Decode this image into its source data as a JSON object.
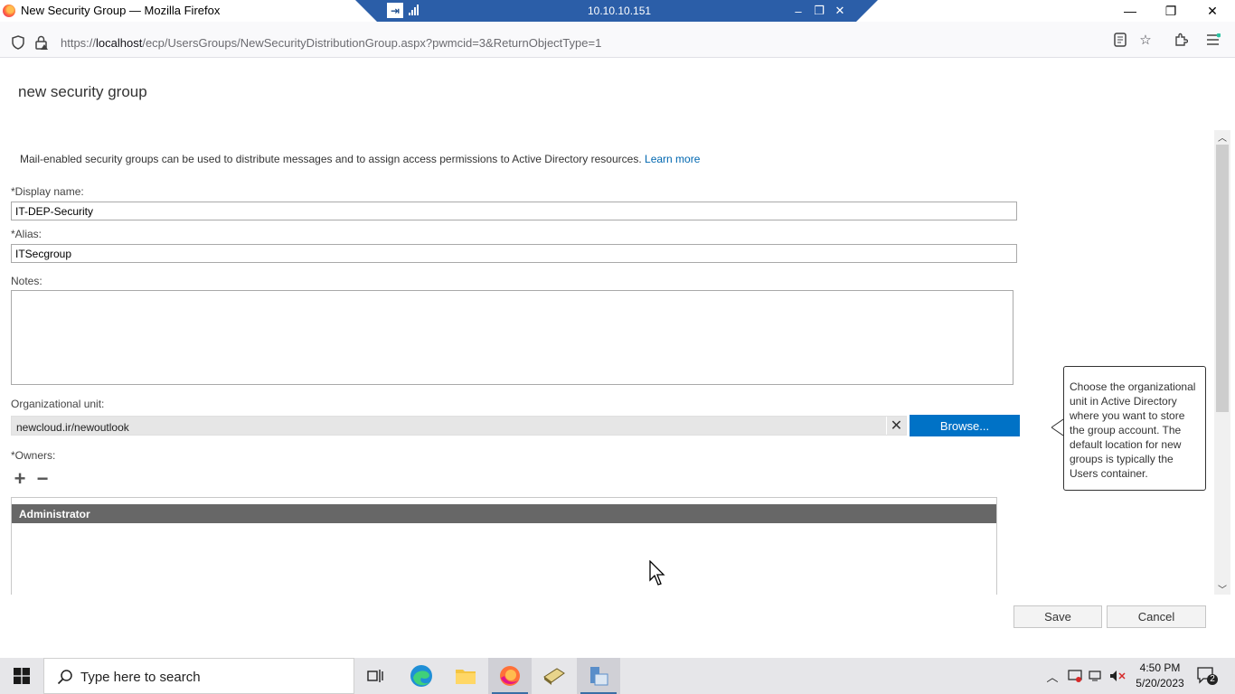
{
  "window": {
    "title": "New Security Group — Mozilla Firefox",
    "minimize": "—",
    "restore": "❐",
    "close": "✕"
  },
  "rdp": {
    "host": "10.10.10.151",
    "pin_icon": "pin-icon",
    "signal_icon": "signal-strength-icon"
  },
  "browser": {
    "url_prefix": "https://",
    "url_host": "localhost",
    "url_path": "/ecp/UsersGroups/NewSecurityDistributionGroup.aspx?pwmcid=3&ReturnObjectType=1"
  },
  "form": {
    "title": "new security group",
    "description": "Mail-enabled security groups can be used to distribute messages and to assign access permissions to Active Directory resources.",
    "learn_more": "Learn more",
    "display_name_label": "*Display name:",
    "display_name_value": "IT-DEP-Security",
    "alias_label": "*Alias:",
    "alias_value": "ITSecgroup",
    "notes_label": "Notes:",
    "notes_value": "",
    "ou_label": "Organizational unit:",
    "ou_value": "newcloud.ir/newoutlook",
    "ou_clear": "✕",
    "browse_label": "Browse...",
    "owners_label": "*Owners:",
    "add_owner": "+",
    "remove_owner": "−",
    "owners": [
      "Administrator"
    ],
    "save_label": "Save",
    "cancel_label": "Cancel"
  },
  "tooltip": {
    "text": "Choose the organizational unit in Active Directory where you want to store the group account. The default location for new groups is typically the Users container."
  },
  "taskbar": {
    "search_placeholder": "Type here to search",
    "time": "4:50 PM",
    "date": "5/20/2023",
    "notification_count": "2"
  },
  "colors": {
    "accent": "#0072c6",
    "rdp_bar": "#2b5ea8",
    "owner_row": "#676767"
  }
}
